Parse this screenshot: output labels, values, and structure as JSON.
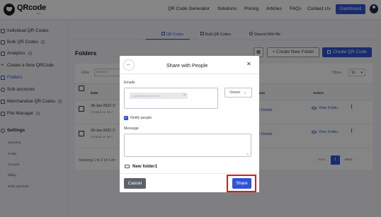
{
  "brand": {
    "name": "QRcode",
    "sub": "Tiger"
  },
  "topnav": {
    "items": [
      "QR Code Generator",
      "Solutions",
      "Pricing",
      "Articles",
      "FAQs",
      "Contact Us"
    ],
    "dashboard_label": "Dashboard"
  },
  "sidebar": {
    "items": [
      {
        "label": "Individual QR Codes"
      },
      {
        "label": "Bulk QR Codes"
      },
      {
        "label": "Analytics"
      },
      {
        "label": "Create a New QRCode"
      },
      {
        "label": "Folders"
      },
      {
        "label": "Sub-accounts"
      },
      {
        "label": "Merchandise QR Codes"
      },
      {
        "label": "File Manager"
      },
      {
        "label": "Settings"
      }
    ],
    "settings_sub": [
      "Overview",
      "Profile",
      "Account",
      "Billing",
      "Refer and Earn"
    ]
  },
  "tabs": [
    "QR Codes",
    "Bulk QR Codes",
    "Shared With Me"
  ],
  "page": {
    "title": "Folders",
    "new_folder_label": "+ Create New Folder",
    "create_qr_label": "Create QR Code",
    "filter_label": "Filter",
    "filter_placeholder": "Search",
    "show_label": "Show",
    "show_value": "10",
    "columns": [
      "Date",
      "Total Scan",
      "Action"
    ],
    "rows": [
      {
        "date": "28-Jan-2022 1!",
        "created": "Created on 28-J",
        "details": "View Details",
        "action": "View Folder"
      },
      {
        "date": "28-Jan-2022 1!",
        "created": "Created on 28-J",
        "details": "View Details",
        "action": "View Folder"
      }
    ],
    "showing": "Showing 1 to 2 of 2 en",
    "prev": "← Prev",
    "page_num": "1",
    "next": "Next →"
  },
  "modal": {
    "title": "Share with People",
    "emails_label": "Emails",
    "email_chip": "myself@example.com",
    "role_value": "Viewer",
    "notify_label": "Notify people",
    "message_label": "Message",
    "folder_name": "New folder1",
    "cancel_label": "Cancel",
    "share_label": "Share"
  },
  "colors": {
    "accent": "#2f55d4",
    "highlight": "#e11b1b",
    "cancel": "#5c6269"
  }
}
